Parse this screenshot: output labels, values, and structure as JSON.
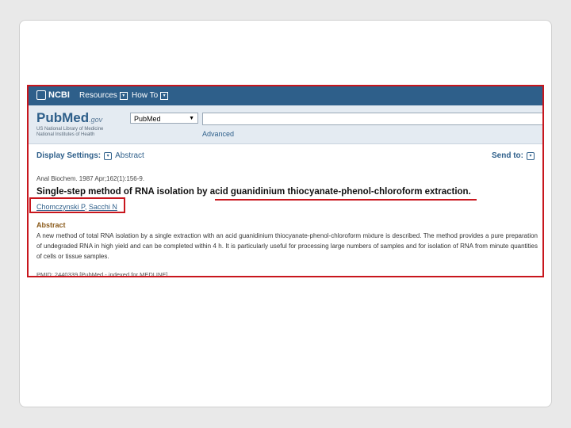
{
  "ncbi_bar": {
    "logo": "NCBI",
    "resources": "Resources",
    "how_to": "How To"
  },
  "header": {
    "logo_pub": "Pub",
    "logo_med": "Med",
    "logo_gov": ".gov",
    "nlm_line1": "US National Library of Medicine",
    "nlm_line2": "National Institutes of Health",
    "db_selected": "PubMed",
    "search_value": "",
    "advanced": "Advanced"
  },
  "settings": {
    "display_label": "Display Settings:",
    "display_value": "Abstract",
    "send_to": "Send to:"
  },
  "article": {
    "citation": "Anal Biochem. 1987 Apr;162(1):156-9.",
    "title": "Single-step method of RNA isolation by acid guanidinium thiocyanate-phenol-chloroform extraction.",
    "author1": "Chomczynski P",
    "author2": "Sacchi N",
    "abstract_heading": "Abstract",
    "abstract_text": "A new method of total RNA isolation by a single extraction with an acid guanidinium thiocyanate-phenol-chloroform mixture is described. The method provides a pure preparation of undegraded RNA in high yield and can be completed within 4 h. It is particularly useful for processing large numbers of samples and for isolation of RNA from minute quantities of cells or tissue samples.",
    "pmid": "PMID: 2440339 [PubMed - indexed for MEDLINE]"
  },
  "colors": {
    "highlight": "#c8161d",
    "ncbi_blue": "#2e5f8a"
  }
}
